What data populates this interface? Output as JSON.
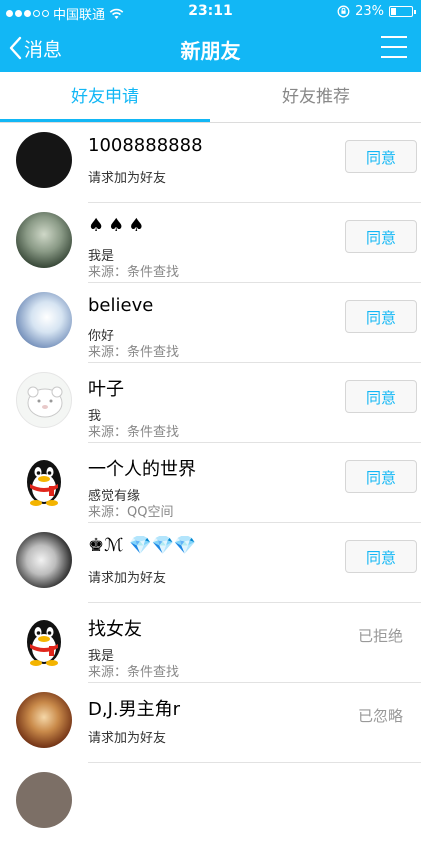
{
  "status_bar": {
    "carrier": "中国联通",
    "time": "23:11",
    "battery": "23%"
  },
  "nav": {
    "back_label": "消息",
    "title": "新朋友"
  },
  "tabs": [
    {
      "label": "好友申请",
      "active": true
    },
    {
      "label": "好友推荐",
      "active": false
    }
  ],
  "requests": [
    {
      "name": "1008888888",
      "message": "请求加为好友",
      "source": "",
      "action": "同意"
    },
    {
      "name": "♠♠♠",
      "message": "我是",
      "source": "来源：条件查找",
      "action": "同意"
    },
    {
      "name": "believe",
      "message": "你好",
      "source": "来源：条件查找",
      "action": "同意"
    },
    {
      "name": "叶子",
      "message": "我",
      "source": "来源：条件查找",
      "action": "同意"
    },
    {
      "name": "一个人的世界",
      "message": "感觉有缘",
      "source": "来源：QQ空间",
      "action": "同意"
    },
    {
      "name": "♚ℳ 💎💎💎",
      "message": "请求加为好友",
      "source": "",
      "action": "同意"
    },
    {
      "name": "找女友",
      "message": "我是",
      "source": "来源：条件查找",
      "action": "已拒绝"
    },
    {
      "name": "D,J.男主角r",
      "message": "请求加为好友",
      "source": "",
      "action": "已忽略"
    }
  ],
  "colors": {
    "accent": "#12b7f5"
  }
}
